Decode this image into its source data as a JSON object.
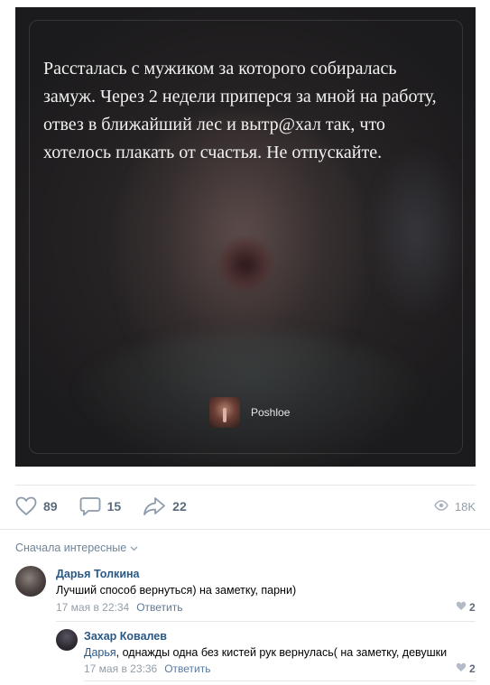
{
  "post": {
    "quote": "Рассталась с мужиком за которого собиралась замуж. Через 2 недели приперся за мной на работу, отвез в ближайший лес и вытр@хал так, что хотелось плакать от счастья. Не отпускайте.",
    "brand": "Poshloe"
  },
  "actions": {
    "likes": "89",
    "comments": "15",
    "shares": "22",
    "views": "18K"
  },
  "comments_sort": "Сначала интересные",
  "comments": [
    {
      "author": "Дарья Толкина",
      "text": "Лучший способ вернуться) на заметку, парни)",
      "date": "17 мая в 22:34",
      "reply_label": "Ответить",
      "likes": "2"
    },
    {
      "author": "Захар Ковалев",
      "mention": "Дарья",
      "text": ", однажды одна без кистей рук вернулась( на заметку, девушки",
      "date": "17 мая в 23:36",
      "reply_label": "Ответить",
      "likes": "2"
    }
  ],
  "icons": {
    "like": "heart-icon",
    "comment": "speech-bubble-icon",
    "share": "share-arrow-icon",
    "views": "eye-icon",
    "sort": "chevron-down-icon",
    "comment_like": "small-heart-icon"
  }
}
